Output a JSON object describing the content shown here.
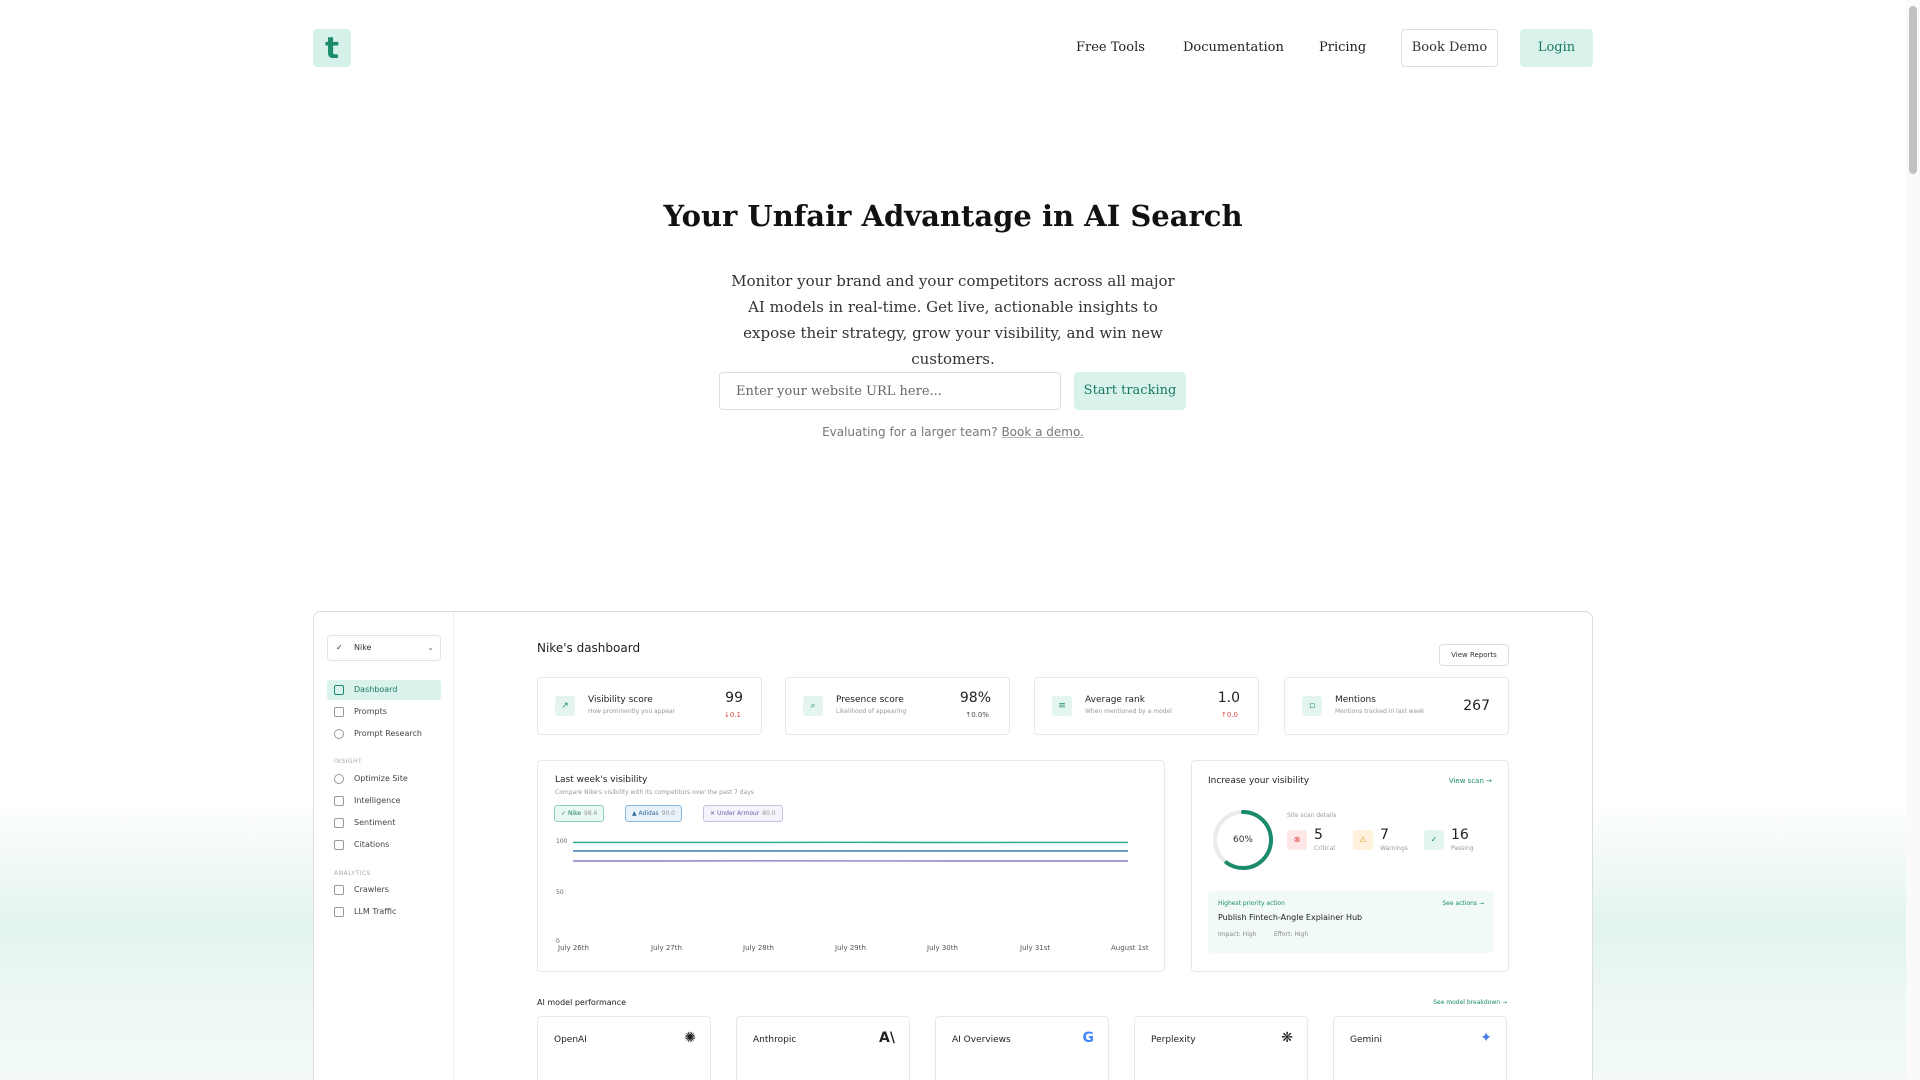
{
  "nav": {
    "logo": "t",
    "links": [
      "Free Tools",
      "Documentation",
      "Pricing"
    ],
    "book_demo": "Book Demo",
    "login": "Login"
  },
  "hero": {
    "title": "Your Unfair Advantage in AI Search",
    "subtitle": "Monitor your brand and your competitors across all major AI models in real-time. Get live, actionable insights to expose their strategy, grow your visibility, and win new customers.",
    "url_placeholder": "Enter your website URL here...",
    "start_button": "Start tracking",
    "eval_text": "Evaluating for a larger team?",
    "eval_link": "Book a demo."
  },
  "dashboard": {
    "brand": "Nike",
    "sidebar": {
      "items": [
        {
          "label": "Dashboard",
          "active": true
        },
        {
          "label": "Prompts"
        },
        {
          "label": "Prompt Research"
        }
      ],
      "insight_label": "INSIGHT",
      "insight_items": [
        "Optimize Site",
        "Intelligence",
        "Sentiment",
        "Citations"
      ],
      "analytics_label": "ANALYTICS",
      "analytics_items": [
        "Crawlers",
        "LLM Traffic"
      ]
    },
    "title": "Nike's dashboard",
    "view_reports": "View Reports",
    "cards": [
      {
        "label": "Visibility score",
        "sub": "How prominently you appear",
        "value": "99",
        "delta": "↓0.1",
        "delta_color": "#e04848"
      },
      {
        "label": "Presence score",
        "sub": "Likelihood of appearing",
        "value": "98%",
        "delta": "↑0.0%",
        "delta_color": "#444444"
      },
      {
        "label": "Average rank",
        "sub": "When mentioned by a model",
        "value": "1.0",
        "delta": "↑0.0",
        "delta_color": "#e04848"
      },
      {
        "label": "Mentions",
        "sub": "Mentions tracked in last week",
        "value": "267",
        "delta": ""
      }
    ],
    "visibility_chart": {
      "title": "Last week's visibility",
      "subtitle": "Compare Nike's visibility with its competitors over the past 7 days",
      "chips": [
        {
          "name": "Nike",
          "value": "98.6"
        },
        {
          "name": "Adidas",
          "value": "90.0"
        },
        {
          "name": "Under Armour",
          "value": "80.0"
        }
      ]
    },
    "increase": {
      "title": "Increase your visibility",
      "view_scan": "View scan →",
      "ring_label": "60%",
      "ring_value": 0.6,
      "scan_details": "Site scan details",
      "stats": [
        {
          "n": "5",
          "label": "Critical"
        },
        {
          "n": "7",
          "label": "Warnings"
        },
        {
          "n": "16",
          "label": "Passing"
        }
      ],
      "priority_header": "Highest priority action",
      "see_actions": "See actions →",
      "priority_title": "Publish Fintech-Angle Explainer Hub",
      "impact": "Impact: High",
      "effort": "Effort: High"
    },
    "ai_perf": {
      "title": "AI model performance",
      "breakdown": "See model breakdown →",
      "models": [
        {
          "name": "OpenAI",
          "icon": "openai-icon"
        },
        {
          "name": "Anthropic",
          "icon": "anthropic-icon"
        },
        {
          "name": "AI Overviews",
          "icon": "google-icon"
        },
        {
          "name": "Perplexity",
          "icon": "perplexity-icon"
        },
        {
          "name": "Gemini",
          "icon": "gemini-icon"
        }
      ]
    }
  },
  "chart_data": {
    "type": "line",
    "x": [
      "July 26th",
      "July 27th",
      "July 28th",
      "July 29th",
      "July 30th",
      "July 31st",
      "August 1st"
    ],
    "ylim": [
      0,
      100
    ],
    "yticks": [
      0,
      50,
      100
    ],
    "series": [
      {
        "name": "Nike",
        "color": "#2aa58a",
        "values": [
          98.6,
          98.6,
          98.6,
          98.7,
          98.5,
          98.6,
          98.6
        ]
      },
      {
        "name": "Adidas",
        "color": "#3a7fb8",
        "values": [
          90,
          90,
          90,
          90,
          90,
          90,
          90
        ]
      },
      {
        "name": "Under Armour",
        "color": "#8a7fc8",
        "values": [
          80,
          80,
          80.2,
          80.1,
          80,
          80,
          80
        ]
      }
    ]
  }
}
